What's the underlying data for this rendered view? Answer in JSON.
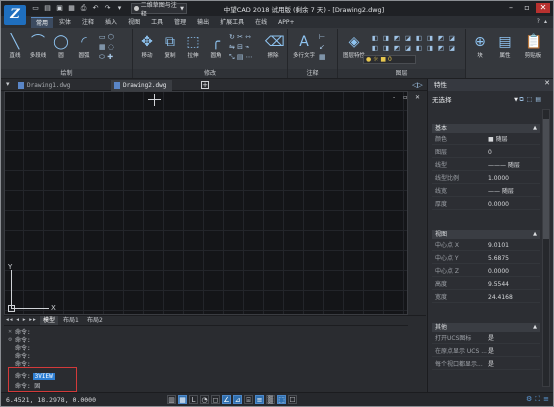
{
  "app": {
    "title": "中望CAD 2018 试用版 (剩余 7 天) - [Drawing2.dwg]",
    "logo_text": "Z",
    "workspace": "二维草图与注释"
  },
  "quick_access": [
    "new-icon",
    "open-icon",
    "save-icon",
    "saveas-icon",
    "print-icon",
    "undo-icon",
    "redo-icon",
    "dropdown-icon"
  ],
  "menu": {
    "items": [
      "常用",
      "实体",
      "注释",
      "插入",
      "视图",
      "工具",
      "管理",
      "输出",
      "扩展工具",
      "在线",
      "APP+"
    ],
    "active_index": 0
  },
  "ribbon": {
    "draw_tools": [
      {
        "label": "直线",
        "icon": "line-icon"
      },
      {
        "label": "多段线",
        "icon": "polyline-icon"
      },
      {
        "label": "圆",
        "icon": "circle-icon"
      },
      {
        "label": "圆弧",
        "icon": "arc-icon"
      }
    ],
    "modify_tools": [
      {
        "label": "移动",
        "icon": "move-icon"
      },
      {
        "label": "复制",
        "icon": "copy-icon"
      },
      {
        "label": "拉伸",
        "icon": "stretch-icon"
      },
      {
        "label": "圆角",
        "icon": "fillet-icon"
      },
      {
        "label": "擦除",
        "icon": "erase-icon"
      }
    ],
    "annot_tool": {
      "label": "多行文字",
      "icon": "text-icon"
    },
    "layer_tool": {
      "label": "图层特性",
      "icon": "layer-icon"
    },
    "layer_combo": "0",
    "block_tools": [
      {
        "label": "块",
        "icon": "block-icon"
      },
      {
        "label": "属性",
        "icon": "attribute-icon"
      },
      {
        "label": "剪贴板",
        "icon": "clipboard-icon"
      }
    ],
    "groups": {
      "draw": "绘制",
      "modify": "修改",
      "annot": "注释",
      "layer": "图层"
    }
  },
  "doc_tabs": {
    "tabs": [
      "Drawing1.dwg",
      "Drawing2.dwg"
    ],
    "active_index": 1
  },
  "canvas": {
    "window_controls": "- ▫ ✕",
    "axis_x": "X",
    "axis_y": "Y"
  },
  "layout_tabs": {
    "nav": "◂◂ ◂ ▸ ▸▸",
    "tabs": [
      "模型",
      "布局1",
      "布局2"
    ],
    "active_index": 0
  },
  "command": {
    "lines": [
      "命令:",
      "命令:",
      "命令:",
      "命令:",
      "命令:"
    ],
    "highlight_prefix": "命令:",
    "highlight_value": "3VIEW",
    "last_prefix": "命令:",
    "last_value": "固"
  },
  "status": {
    "coords": "6.4521, 18.2978, 0.0000"
  },
  "properties": {
    "title": "特性",
    "selection": "无选择",
    "sections": {
      "basic": {
        "title": "基本",
        "rows": [
          {
            "k": "颜色",
            "v": "■ 随层"
          },
          {
            "k": "图层",
            "v": "0"
          },
          {
            "k": "线型",
            "v": "——— 随层"
          },
          {
            "k": "线型比例",
            "v": "1.0000"
          },
          {
            "k": "线宽",
            "v": "—— 随层"
          },
          {
            "k": "厚度",
            "v": "0.0000"
          }
        ]
      },
      "view": {
        "title": "视图",
        "rows": [
          {
            "k": "中心点 X",
            "v": "9.0101"
          },
          {
            "k": "中心点 Y",
            "v": "5.6875"
          },
          {
            "k": "中心点 Z",
            "v": "0.0000"
          },
          {
            "k": "高度",
            "v": "9.5544"
          },
          {
            "k": "宽度",
            "v": "24.4168"
          }
        ]
      },
      "other": {
        "title": "其他",
        "rows": [
          {
            "k": "打开UCS图标",
            "v": "是"
          },
          {
            "k": "在原点显示 UCS ...",
            "v": "是"
          },
          {
            "k": "每个视口都显示...",
            "v": "是"
          }
        ]
      }
    }
  }
}
